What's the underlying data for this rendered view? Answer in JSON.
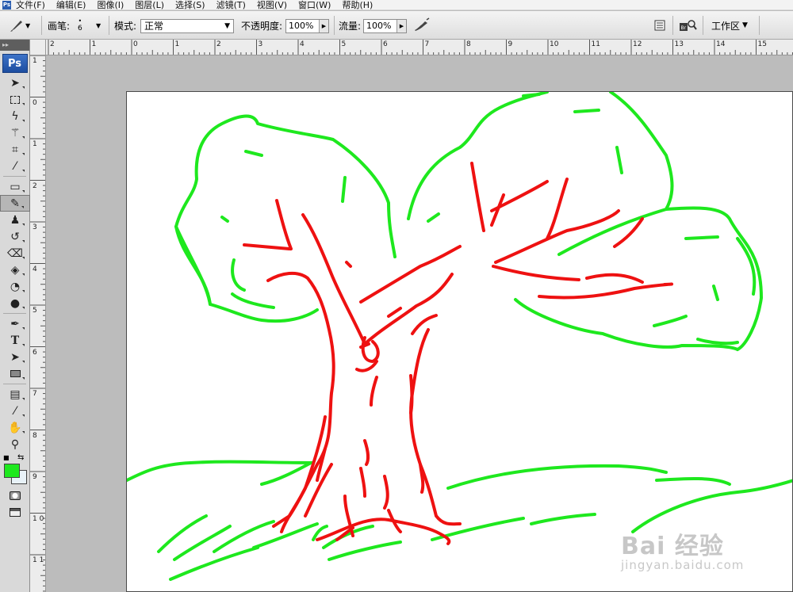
{
  "menubar": {
    "items": [
      "文件(F)",
      "编辑(E)",
      "图像(I)",
      "图层(L)",
      "选择(S)",
      "滤镜(T)",
      "视图(V)",
      "窗口(W)",
      "帮助(H)"
    ]
  },
  "options": {
    "brush_label": "画笔:",
    "brush_size": "6",
    "mode_label": "模式:",
    "mode_value": "正常",
    "opacity_label": "不透明度:",
    "opacity_value": "100%",
    "flow_label": "流量:",
    "flow_value": "100%",
    "workspace_label": "工作区"
  },
  "toolbox": {
    "grip": "▸▸",
    "logo": "Ps",
    "foreground_color": "#1ee81e",
    "background_color": "#e8f2f8"
  },
  "ruler_top": [
    "2",
    "1",
    "0",
    "1",
    "2",
    "3",
    "4",
    "5",
    "6",
    "7",
    "8",
    "9",
    "10",
    "11",
    "12",
    "13",
    "14",
    "15"
  ],
  "ruler_left": [
    "1",
    "0",
    "1",
    "2",
    "3",
    "4",
    "5",
    "6",
    "7",
    "8",
    "9",
    "1 0",
    "1 1"
  ],
  "canvas": {
    "trunk_color": "#ee1111",
    "foliage_color": "#1ee81e"
  },
  "watermark": {
    "logo": "Bai 经验",
    "url": "jingyan.baidu.com"
  }
}
